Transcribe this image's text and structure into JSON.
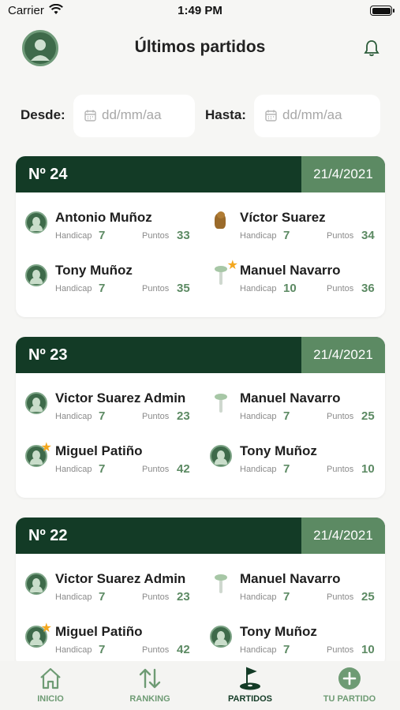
{
  "status": {
    "carrier": "Carrier",
    "time": "1:49 PM"
  },
  "header": {
    "title": "Últimos partidos"
  },
  "filters": {
    "desde_label": "Desde:",
    "hasta_label": "Hasta:",
    "desde_placeholder": "dd/mm/aa",
    "hasta_placeholder": "dd/mm/aa"
  },
  "labels": {
    "handicap": "Handicap",
    "puntos": "Puntos"
  },
  "matches": [
    {
      "number": "Nº 24",
      "date": "21/4/2021",
      "players": [
        {
          "name": "Antonio Muñoz",
          "handicap": "7",
          "puntos": "33",
          "avatar": "photo",
          "star": false
        },
        {
          "name": "Víctor Suarez",
          "handicap": "7",
          "puntos": "34",
          "avatar": "bird",
          "star": false
        },
        {
          "name": "Tony Muñoz",
          "handicap": "7",
          "puntos": "35",
          "avatar": "photo",
          "star": false
        },
        {
          "name": "Manuel Navarro",
          "handicap": "10",
          "puntos": "36",
          "avatar": "tree",
          "star": true
        }
      ]
    },
    {
      "number": "Nº 23",
      "date": "21/4/2021",
      "players": [
        {
          "name": "Victor Suarez Admin",
          "handicap": "7",
          "puntos": "23",
          "avatar": "photo",
          "star": false
        },
        {
          "name": "Manuel Navarro",
          "handicap": "7",
          "puntos": "25",
          "avatar": "tree",
          "star": false
        },
        {
          "name": "Miguel Patiño",
          "handicap": "7",
          "puntos": "42",
          "avatar": "photo",
          "star": true
        },
        {
          "name": "Tony Muñoz",
          "handicap": "7",
          "puntos": "10",
          "avatar": "photo",
          "star": false
        }
      ]
    },
    {
      "number": "Nº 22",
      "date": "21/4/2021",
      "players": [
        {
          "name": "Victor Suarez Admin",
          "handicap": "7",
          "puntos": "23",
          "avatar": "photo",
          "star": false
        },
        {
          "name": "Manuel Navarro",
          "handicap": "7",
          "puntos": "25",
          "avatar": "tree",
          "star": false
        },
        {
          "name": "Miguel Patiño",
          "handicap": "7",
          "puntos": "42",
          "avatar": "photo",
          "star": true
        },
        {
          "name": "Tony Muñoz",
          "handicap": "7",
          "puntos": "10",
          "avatar": "photo",
          "star": false
        }
      ]
    }
  ],
  "tabs": [
    {
      "label": "INICIO",
      "icon": "home-icon",
      "active": false
    },
    {
      "label": "RANKING",
      "icon": "ranking-icon",
      "active": false
    },
    {
      "label": "PARTIDOS",
      "icon": "golf-flag-icon",
      "active": true
    },
    {
      "label": "TU PARTIDO",
      "icon": "add-circle-icon",
      "active": false
    }
  ],
  "colors": {
    "primary": "#133b26",
    "accent": "#5c8a63",
    "star": "#f3a71e"
  }
}
